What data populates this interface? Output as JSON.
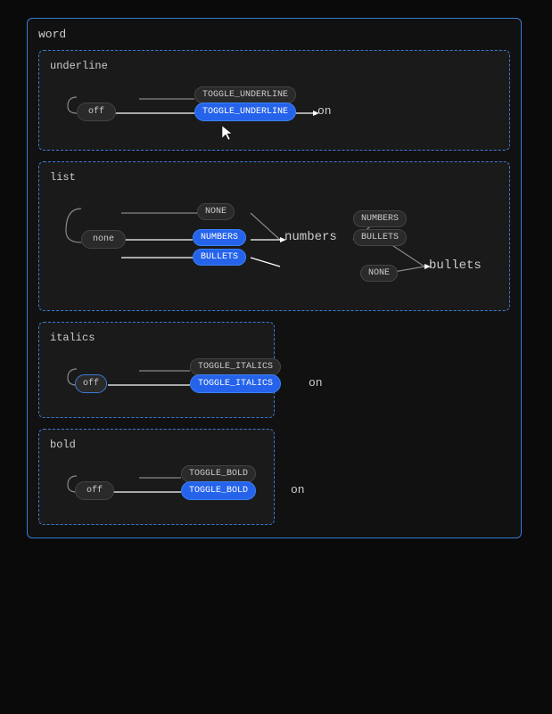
{
  "outer": {
    "title": "word"
  },
  "underline": {
    "title": "underline",
    "nodes": {
      "toggle_top": "TOGGLE_UNDERLINE",
      "toggle_bottom": "TOGGLE_UNDERLINE",
      "off": "off",
      "on": "on"
    }
  },
  "list": {
    "title": "list",
    "nodes": {
      "none": "none",
      "none_dark": "NONE",
      "numbers_dark": "NUMBERS",
      "bullets_dark": "BULLETS",
      "numbers_blue": "NUMBERS",
      "bullets_blue": "BULLETS",
      "numbers_text": "numbers",
      "bullets_text": "bullets",
      "none_bottom": "NONE"
    }
  },
  "italics": {
    "title": "italics",
    "nodes": {
      "toggle_top": "TOGGLE_ITALICS",
      "toggle_bottom": "TOGGLE_ITALICS",
      "off": "off",
      "on": "on"
    }
  },
  "bold": {
    "title": "bold",
    "nodes": {
      "toggle_top": "TOGGLE_BOLD",
      "toggle_bottom": "TOGGLE_BOLD",
      "off": "off",
      "on": "on"
    }
  },
  "colors": {
    "blue": "#2563eb",
    "dark_bg": "#1a1a1a",
    "border_blue": "#3a7bd5"
  }
}
